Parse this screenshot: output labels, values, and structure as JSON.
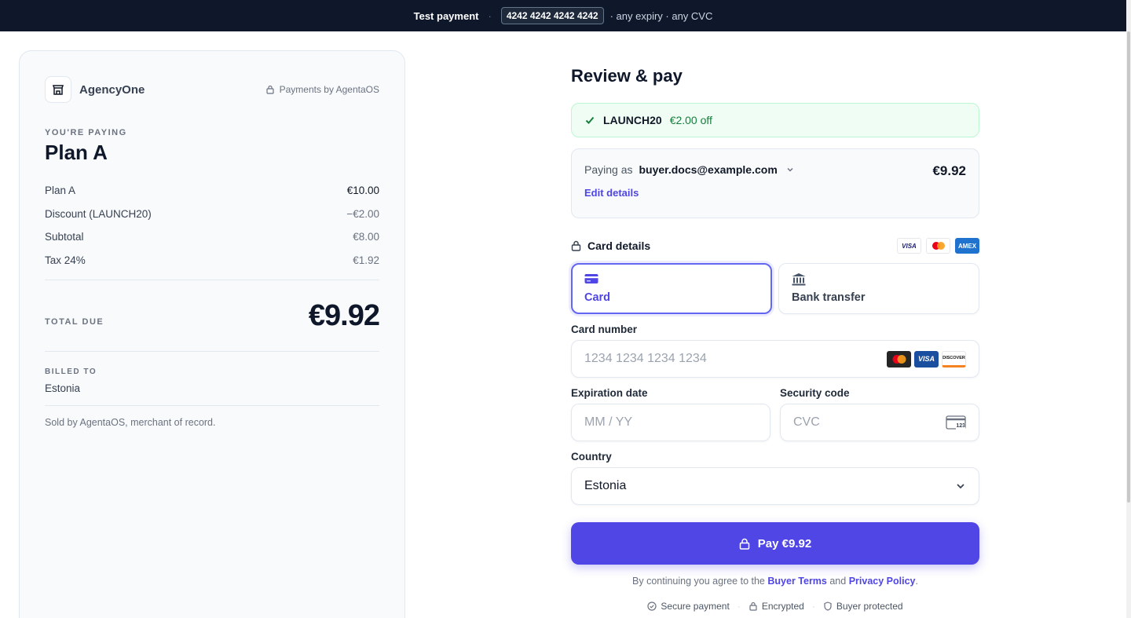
{
  "banner": {
    "label": "Test payment",
    "separator": "·",
    "card": "4242 4242 4242 4242",
    "hint": "· any expiry · any CVC"
  },
  "summary": {
    "merchant": "AgencyOne",
    "powered_by": "Payments by AgentaOS",
    "eyebrow": "YOU'RE PAYING",
    "plan": "Plan A",
    "lines": [
      {
        "label": "Plan A",
        "amount": "€10.00"
      },
      {
        "label": "Discount (LAUNCH20)",
        "amount": "−€2.00"
      },
      {
        "label": "Subtotal",
        "amount": "€8.00"
      },
      {
        "label": "Tax 24%",
        "amount": "€1.92"
      }
    ],
    "total_label": "TOTAL DUE",
    "total_amount": "€9.92",
    "billed_label": "BILLED TO",
    "billed_value": "Estonia",
    "sold_by": "Sold by AgentaOS, merchant of record."
  },
  "checkout": {
    "heading": "Review & pay",
    "promo_code": "LAUNCH20",
    "promo_discount": "€2.00 off",
    "paying_as_label": "Paying as",
    "email": "buyer.docs@example.com",
    "amount": "€9.92",
    "edit_label": "Edit details",
    "card_details_label": "Card details",
    "brands": [
      "VISA",
      "AMEX"
    ],
    "methods": [
      {
        "label": "Card",
        "active": true
      },
      {
        "label": "Bank transfer",
        "active": false
      }
    ],
    "card_number_label": "Card number",
    "card_number_placeholder": "1234 1234 1234 1234",
    "card_logo_labels": [
      "VISA",
      "DISCOVER"
    ],
    "expiry_label": "Expiration date",
    "expiry_placeholder": "MM / YY",
    "cvc_label": "Security code",
    "cvc_placeholder": "CVC",
    "cvc_icon_text": "123",
    "country_label": "Country",
    "country_value": "Estonia",
    "pay_label": "Pay €9.92",
    "terms_prefix": "By continuing you agree to the",
    "terms_link": "Buyer Terms",
    "terms_and": "and",
    "privacy_link": "Privacy Policy",
    "terms_suffix": ".",
    "trust": [
      "Secure payment",
      "Encrypted",
      "Buyer protected"
    ]
  },
  "colors": {
    "accent": "#4f46e5",
    "banner_bg": "#0f172a",
    "success": "#15803d"
  }
}
